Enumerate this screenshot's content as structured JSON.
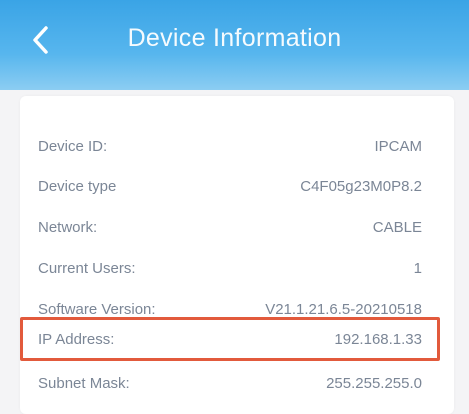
{
  "header": {
    "title": "Device Information"
  },
  "colors": {
    "header_top": "#3aa4e6",
    "header_bottom": "#8ccdf2",
    "highlight_border": "#e25a3c",
    "text": "#7b8696"
  },
  "icons": {
    "back": "chevron-left-icon"
  },
  "rows": [
    {
      "label": "Device ID:",
      "value": "IPCAM"
    },
    {
      "label": "Device type",
      "value": "C4F05g23M0P8.2"
    },
    {
      "label": "Network:",
      "value": "CABLE"
    },
    {
      "label": "Current Users:",
      "value": "1"
    },
    {
      "label": "Software Version:",
      "value": "V21.1.21.6.5-20210518"
    },
    {
      "label": "IP Address:",
      "value": "192.168.1.33"
    },
    {
      "label": "Subnet Mask:",
      "value": "255.255.255.0"
    }
  ]
}
